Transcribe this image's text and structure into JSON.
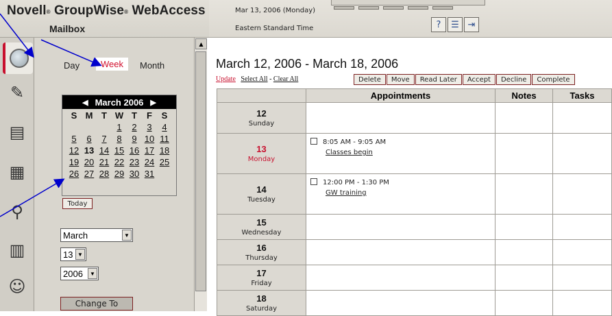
{
  "header": {
    "brand": "Novell",
    "brand2": "GroupWise",
    "brand3": "WebAccess",
    "section": "Mailbox",
    "date": "Mar 13, 2006 (Monday)",
    "timezone": "Eastern Standard Time",
    "toolbar_icons": [
      "help-icon",
      "options-icon",
      "exit-icon"
    ]
  },
  "sidebar": {
    "icons": [
      "calendar-globe-icon",
      "compose-icon",
      "address-book-icon",
      "calendar-grid-icon",
      "search-icon",
      "library-icon",
      "users-icon"
    ]
  },
  "nav": {
    "views": [
      "Day",
      "Week",
      "Month"
    ],
    "selected_view": "Week",
    "mini_calendar": {
      "title": "March 2006",
      "dow": [
        "S",
        "M",
        "T",
        "W",
        "T",
        "F",
        "S"
      ],
      "weeks": [
        [
          "",
          "",
          "",
          "1",
          "2",
          "3",
          "4"
        ],
        [
          "5",
          "6",
          "7",
          "8",
          "9",
          "10",
          "11"
        ],
        [
          "12",
          "13",
          "14",
          "15",
          "16",
          "17",
          "18"
        ],
        [
          "19",
          "20",
          "21",
          "22",
          "23",
          "24",
          "25"
        ],
        [
          "26",
          "27",
          "28",
          "29",
          "30",
          "31",
          ""
        ]
      ],
      "today": "13"
    },
    "today_label": "Today",
    "month_select": "March",
    "day_select": "13",
    "year_select": "2006",
    "change_label": "Change To"
  },
  "main": {
    "range_title": "March 12, 2006  -  March 18, 2006",
    "links": {
      "update": "Update",
      "select_all": "Select All",
      "sep": " - ",
      "clear_all": "Clear All"
    },
    "actions": [
      "Delete",
      "Move",
      "Read Later",
      "Accept",
      "Decline",
      "Complete"
    ],
    "columns": {
      "appointments": "Appointments",
      "notes": "Notes",
      "tasks": "Tasks"
    },
    "days": [
      {
        "num": "12",
        "name": "Sunday",
        "appt_time": "",
        "appt_subject": ""
      },
      {
        "num": "13",
        "name": "Monday",
        "appt_time": "8:05 AM - 9:05 AM",
        "appt_subject": "Classes begin"
      },
      {
        "num": "14",
        "name": "Tuesday",
        "appt_time": "12:00 PM - 1:30 PM",
        "appt_subject": "GW training"
      },
      {
        "num": "15",
        "name": "Wednesday",
        "appt_time": "",
        "appt_subject": ""
      },
      {
        "num": "16",
        "name": "Thursday",
        "appt_time": "",
        "appt_subject": ""
      },
      {
        "num": "17",
        "name": "Friday",
        "appt_time": "",
        "appt_subject": ""
      },
      {
        "num": "18",
        "name": "Saturday",
        "appt_time": "",
        "appt_subject": ""
      }
    ]
  },
  "colors": {
    "accent_red": "#c8102e",
    "panel": "#d9d6ce",
    "annotation_blue": "#0000cc"
  }
}
